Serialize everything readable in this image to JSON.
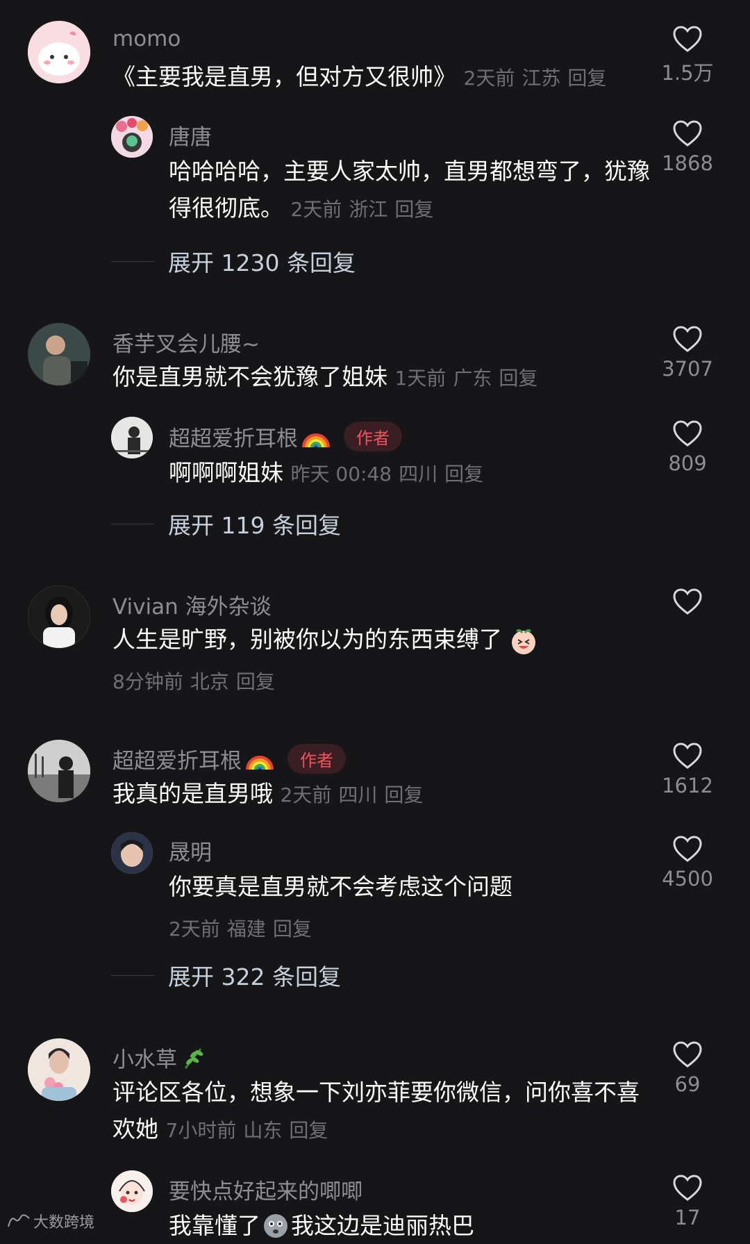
{
  "comments": [
    {
      "user": "momo",
      "text": "《主要我是直男，但对方又很帅》",
      "time": "2天前",
      "location": "江苏",
      "reply": "回复",
      "likes": "1.5万",
      "replies": [
        {
          "user": "唐唐",
          "text": "哈哈哈哈，主要人家太帅，直男都想弯了，犹豫得很彻底。",
          "time": "2天前",
          "location": "浙江",
          "reply": "回复",
          "likes": "1868"
        }
      ],
      "expand": "展开 1230 条回复"
    },
    {
      "user": "香芋叉会儿腰~",
      "text": "你是直男就不会犹豫了姐妹",
      "time": "1天前",
      "location": "广东",
      "reply": "回复",
      "likes": "3707",
      "replies": [
        {
          "user": "超超爱折耳根",
          "badge": "作者",
          "text": "啊啊啊姐妹",
          "time": "昨天 00:48",
          "location": "四川",
          "reply": "回复",
          "likes": "809"
        }
      ],
      "expand": "展开 119 条回复"
    },
    {
      "user": "Vivian 海外杂谈",
      "text": "人生是旷野，别被你以为的东西束缚了",
      "time": "8分钟前",
      "location": "北京",
      "reply": "回复",
      "likes": ""
    },
    {
      "user": "超超爱折耳根",
      "badge": "作者",
      "text": "我真的是直男哦",
      "time": "2天前",
      "location": "四川",
      "reply": "回复",
      "likes": "1612",
      "replies": [
        {
          "user": "晟明",
          "text": "你要真是直男就不会考虑这个问题",
          "time": "2天前",
          "location": "福建",
          "reply": "回复",
          "likes": "4500"
        }
      ],
      "expand": "展开 322 条回复"
    },
    {
      "user": "小水草",
      "text": "评论区各位，想象一下刘亦菲要你微信，问你喜不喜欢她",
      "time": "7小时前",
      "location": "山东",
      "reply": "回复",
      "likes": "69",
      "replies": [
        {
          "user": "要快点好起来的唧唧",
          "text": "我靠懂了",
          "text2": "我这边是迪丽热巴",
          "likes": "17"
        }
      ]
    }
  ],
  "watermark": "大数跨境",
  "colors": {
    "background": "#161619",
    "badge_text": "#f2545c",
    "badge_bg": "#3a1e24",
    "expand_text": "#c7d0dc"
  }
}
